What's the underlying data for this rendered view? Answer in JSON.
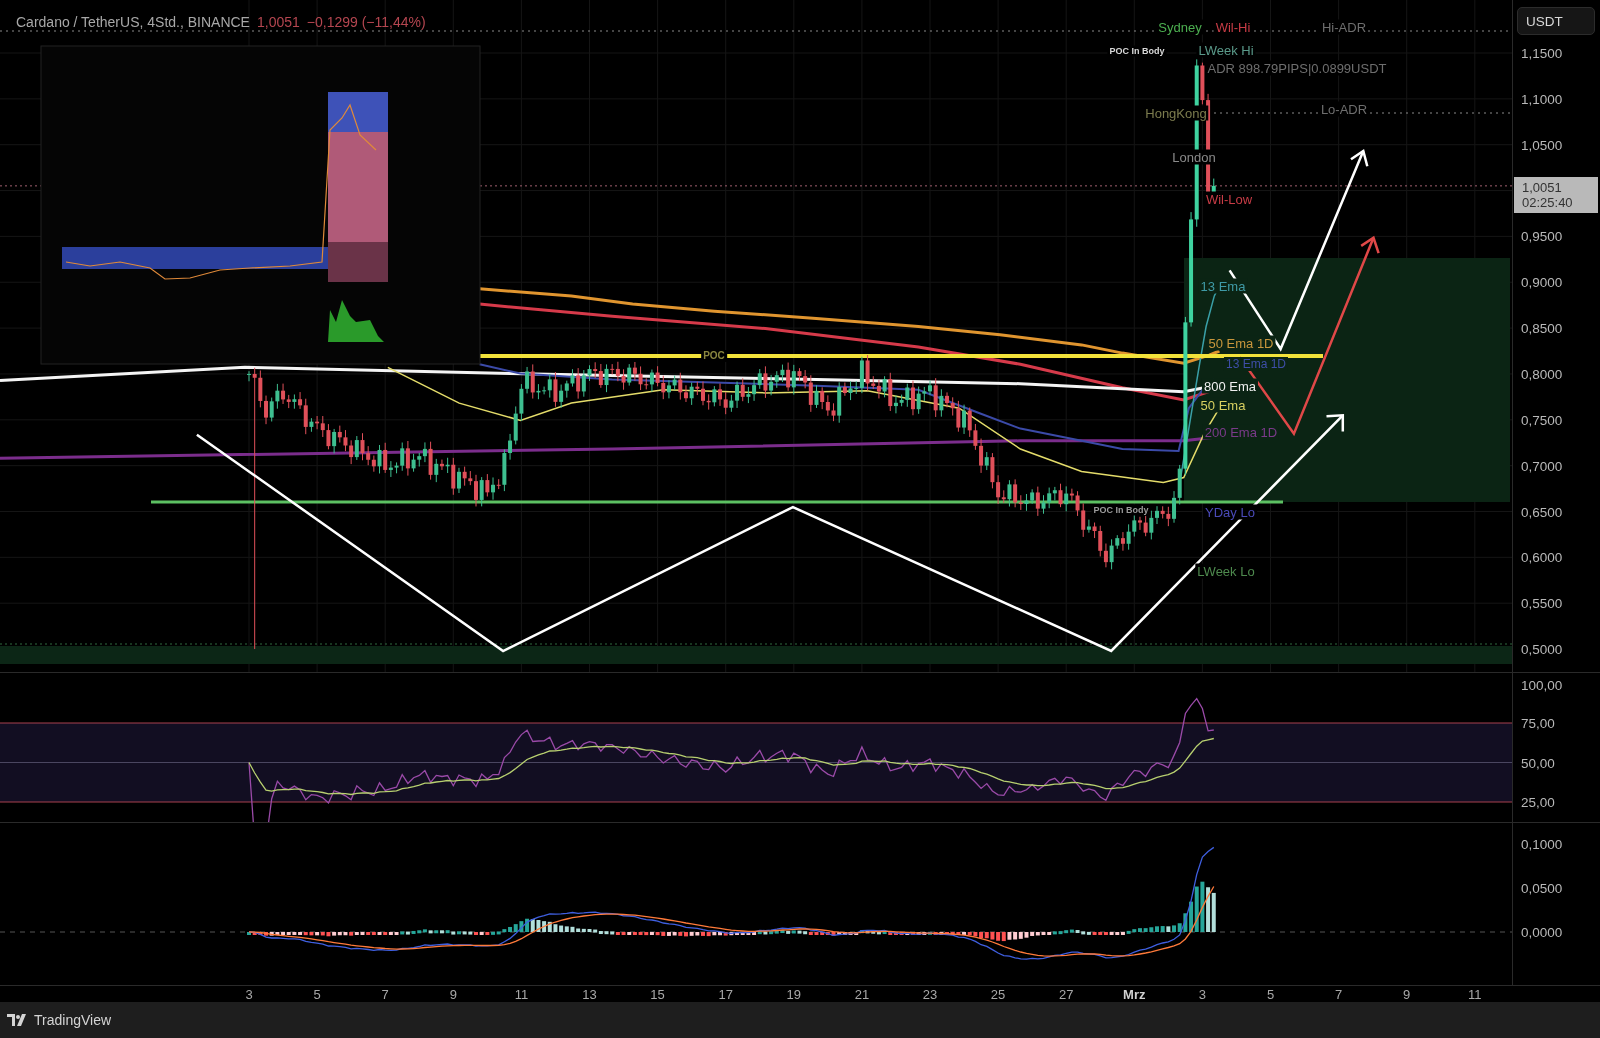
{
  "header": {
    "symbol": "Cardano / TetherUS, 4Std., BINANCE",
    "last_price": "1,0051",
    "change": "−0,1299 (−11,44%)"
  },
  "price_axis": {
    "currency_button": "USDT",
    "labels": [
      "1,1500",
      "1,1000",
      "1,0500",
      "0,9500",
      "0,9000",
      "0,8500",
      "0,8000",
      "0,7500",
      "0,7000",
      "0,6500",
      "0,6000",
      "0,5500",
      "0,5000"
    ],
    "price_tag": {
      "price": "1,0051",
      "countdown": "02:25:40"
    }
  },
  "annotations": [
    {
      "text": "Sydney",
      "color": "#4caf50"
    },
    {
      "text": "Wil-Hi",
      "color": "#c83c46"
    },
    {
      "text": "Hi-ADR",
      "color": "#6e6e6e"
    },
    {
      "text": "POC In Body",
      "color": "#d8d8d8"
    },
    {
      "text": "LWeek Hi",
      "color": "#5a9a8a"
    },
    {
      "text": "ADR 898.79PIPS|0.0899USDT",
      "color": "#6e6e6e"
    },
    {
      "text": "HongKong",
      "color": "#7c7c4e"
    },
    {
      "text": "Lo-ADR",
      "color": "#6e6e6e"
    },
    {
      "text": "London",
      "color": "#8a8a8a"
    },
    {
      "text": "Wil-Low",
      "color": "#c83c46"
    },
    {
      "text": "13 Ema",
      "color": "#3f9aa6"
    },
    {
      "text": "50 Ema 1D",
      "color": "#c8963c"
    },
    {
      "text": "13 Ema 1D",
      "color": "#3e4ea8"
    },
    {
      "text": "800 Ema",
      "color": "#f0f0f0"
    },
    {
      "text": "50 Ema",
      "color": "#d8d060"
    },
    {
      "text": "200 Ema 1D",
      "color": "#7a3a8a"
    },
    {
      "text": "POC",
      "color": "#8a8640"
    },
    {
      "text": "POC In Body",
      "color": "#9a9a9a"
    },
    {
      "text": "YDay Lo",
      "color": "#4a4ab8"
    },
    {
      "text": "LWeek Lo",
      "color": "#4e8a4e"
    }
  ],
  "rsi_axis": {
    "labels": [
      "100,00",
      "75,00",
      "50,00",
      "25,00"
    ]
  },
  "macd_axis": {
    "labels": [
      "0,1000",
      "0,0500",
      "0,0000"
    ]
  },
  "time_axis": {
    "labels": [
      {
        "text": "3",
        "kind": "day"
      },
      {
        "text": "5",
        "kind": "day"
      },
      {
        "text": "7",
        "kind": "day"
      },
      {
        "text": "9",
        "kind": "day"
      },
      {
        "text": "11",
        "kind": "day"
      },
      {
        "text": "13",
        "kind": "day"
      },
      {
        "text": "15",
        "kind": "day"
      },
      {
        "text": "17",
        "kind": "day"
      },
      {
        "text": "19",
        "kind": "day"
      },
      {
        "text": "21",
        "kind": "day"
      },
      {
        "text": "23",
        "kind": "day"
      },
      {
        "text": "25",
        "kind": "day"
      },
      {
        "text": "27",
        "kind": "day"
      },
      {
        "text": "Mrz",
        "kind": "month"
      },
      {
        "text": "3",
        "kind": "day"
      },
      {
        "text": "5",
        "kind": "day"
      },
      {
        "text": "7",
        "kind": "day"
      },
      {
        "text": "9",
        "kind": "day"
      },
      {
        "text": "11",
        "kind": "day"
      }
    ]
  },
  "footer": {
    "brand": "TradingView"
  }
}
